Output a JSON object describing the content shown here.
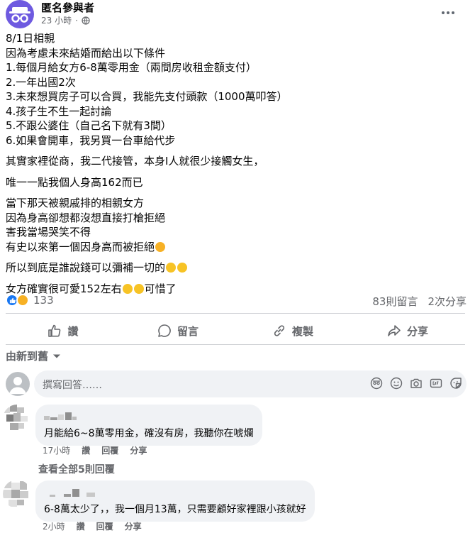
{
  "post": {
    "author": "匿名參與者",
    "time": "23 小時",
    "paragraphs": [
      [
        "8/1日相親",
        "因為考慮未來結婚而給出以下條件",
        "1.每個月給女方6-8萬零用金（兩間房收租金額支付）",
        "2.一年出國2次",
        "3.未來想買房子可以合買，我能先支付頭款（1000萬叩答）",
        "4.孩子生不生一起討論",
        "5.不跟公婆住（自己名下就有3間）",
        "6.如果會開車，我另買一台車給代步"
      ],
      [
        "其實家裡從商，我二代接管，本身I人就很少接觸女生，"
      ],
      [
        "唯一一點我個人身高162而已"
      ],
      [
        "當下那天被親戚排的相親女方",
        "因為身高卻想都沒想直接打槍拒絕",
        "害我當場哭笑不得"
      ],
      [
        "所以到底是誰說錢可以彌補一切的"
      ],
      [
        "女方確實很可愛152左右"
      ]
    ],
    "line_no_more_than_once": "有史以來第一個因身高而被拒絕",
    "last_line_tail": "可惜了"
  },
  "stats": {
    "reaction_count": "133",
    "comments": "83則留言",
    "shares": "2次分享"
  },
  "actions": {
    "like": "讚",
    "comment": "留言",
    "copy": "複製",
    "share": "分享"
  },
  "sort": {
    "label": "由新到舊"
  },
  "composer": {
    "placeholder": "撰寫回答……"
  },
  "comments": [
    {
      "text": "月能給6~8萬零用金，確沒有房，我聽你在唬爛",
      "time": "17小時",
      "like": "讚",
      "reply": "回覆",
      "share": "分享"
    },
    {
      "text": "6-8萬太少了，，我一個月13萬，只需要顧好家裡跟小孩就好",
      "time": "2小時",
      "like": "讚",
      "reply": "回覆",
      "share": "分享"
    }
  ],
  "view_replies": "查看全部5則回覆",
  "colors": {
    "accent_blue": "#1877f2",
    "secondary_text": "#65676b",
    "bubble": "#f0f2f5",
    "avatar_purple": "#6e5ae0"
  }
}
